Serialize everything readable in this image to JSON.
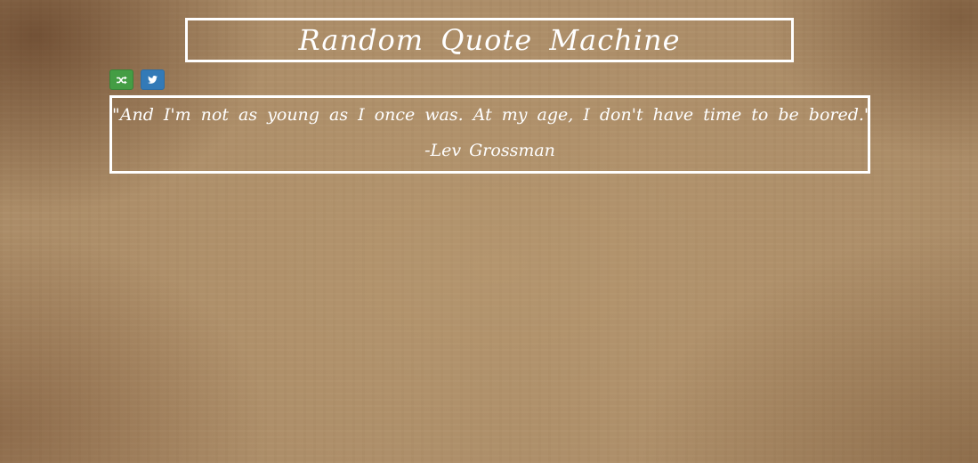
{
  "header": {
    "title": "Random Quote Machine"
  },
  "toolbar": {
    "new_quote_icon": "shuffle-icon",
    "tweet_icon": "twitter-icon"
  },
  "quote": {
    "text": "\"And I'm not as young as I once was. At my age, I don't have time to be bored.\"",
    "author": "-Lev Grossman"
  },
  "colors": {
    "new_quote_button": "#449d44",
    "tweet_button": "#337ab7",
    "border": "#ffffff",
    "text": "#ffffff"
  }
}
